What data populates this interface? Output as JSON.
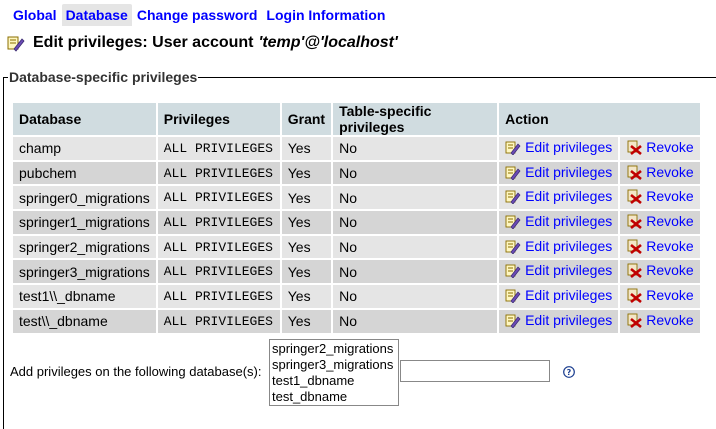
{
  "tabs": [
    {
      "label": "Global",
      "active": false
    },
    {
      "label": "Database",
      "active": true
    },
    {
      "label": "Change password",
      "active": false
    },
    {
      "label": "Login Information",
      "active": false
    }
  ],
  "heading": {
    "prefix": "Edit privileges: User account",
    "account": "'temp'@'localhost'",
    "icon": "edit-privileges-icon"
  },
  "fieldset": {
    "legend": "Database-specific privileges"
  },
  "table": {
    "columns": [
      "Database",
      "Privileges",
      "Grant",
      "Table-specific privileges",
      "Action"
    ],
    "edit_label": "Edit privileges",
    "revoke_label": "Revoke",
    "rows": [
      {
        "database": "champ",
        "privileges": "ALL PRIVILEGES",
        "grant": "Yes",
        "table_specific": "No"
      },
      {
        "database": "pubchem",
        "privileges": "ALL PRIVILEGES",
        "grant": "Yes",
        "table_specific": "No"
      },
      {
        "database": "springer0_migrations",
        "privileges": "ALL PRIVILEGES",
        "grant": "Yes",
        "table_specific": "No"
      },
      {
        "database": "springer1_migrations",
        "privileges": "ALL PRIVILEGES",
        "grant": "Yes",
        "table_specific": "No"
      },
      {
        "database": "springer2_migrations",
        "privileges": "ALL PRIVILEGES",
        "grant": "Yes",
        "table_specific": "No"
      },
      {
        "database": "springer3_migrations",
        "privileges": "ALL PRIVILEGES",
        "grant": "Yes",
        "table_specific": "No"
      },
      {
        "database": "test1\\\\_dbname",
        "privileges": "ALL PRIVILEGES",
        "grant": "Yes",
        "table_specific": "No"
      },
      {
        "database": "test\\\\_dbname",
        "privileges": "ALL PRIVILEGES",
        "grant": "Yes",
        "table_specific": "No"
      }
    ]
  },
  "add_privileges": {
    "label": "Add privileges on the following database(s):",
    "options": [
      "springer2_migrations",
      "springer3_migrations",
      "test1_dbname",
      "test_dbname"
    ],
    "input_value": "",
    "help_icon": "help-icon"
  },
  "colors": {
    "link": "#0000ff",
    "header_bg": "#d0dce0",
    "row_odd": "#e5e5e5",
    "row_even": "#d5d5d5",
    "active_tab": "#e5e5e5"
  }
}
